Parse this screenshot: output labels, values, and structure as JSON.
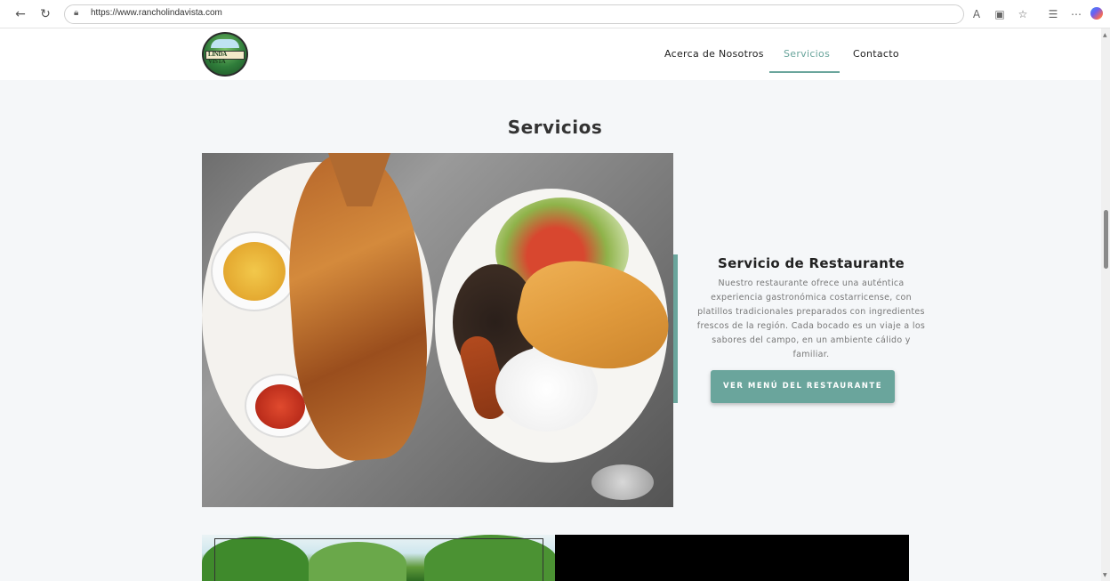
{
  "browser": {
    "url": "https://www.rancholindavista.com"
  },
  "site": {
    "logo_text": "LINDA VISTA",
    "nav": [
      {
        "label": "Acerca de Nosotros",
        "active": false
      },
      {
        "label": "Servicios",
        "active": true
      },
      {
        "label": "Contacto",
        "active": false
      }
    ],
    "accent_color": "#6aa59c"
  },
  "main": {
    "section_title": "Servicios",
    "service": {
      "title": "Servicio de Restaurante",
      "description": "Nuestro restaurante ofrece una auténtica experiencia gastronómica costarricense, con platillos tradicionales preparados con ingredientes frescos de la región. Cada bocado es un viaje a los sabores del campo, en un ambiente cálido y familiar.",
      "button_label": "VER MENÚ DEL RESTAURANTE"
    }
  }
}
